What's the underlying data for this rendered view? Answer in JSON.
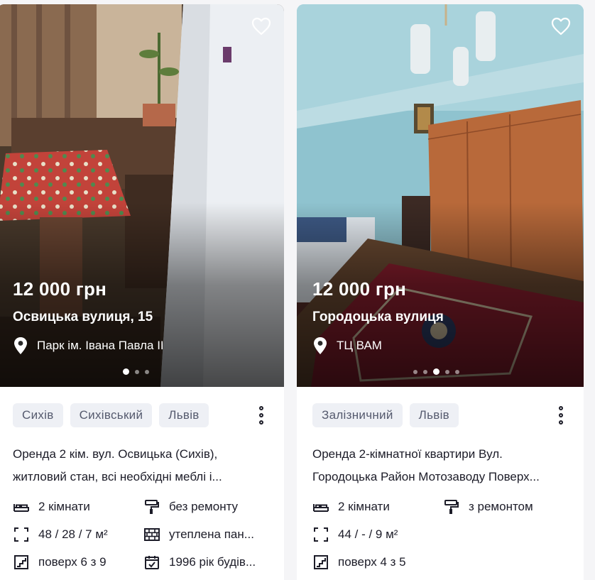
{
  "listings": [
    {
      "price": "12 000 грн",
      "street": "Освицька вулиця, 15",
      "district": "Парк ім. Івана Павла II",
      "favorite_icon": "heart-outline-icon",
      "tags": [
        "Сихів",
        "Сихівський",
        "Львів"
      ],
      "description": [
        "Оренда 2 кім. вул. Освицька (Сихів),",
        "житловий стан, всі необхідні меблі і..."
      ],
      "features": {
        "rooms": "2 кімнати",
        "area": "48 / 28 / 7 м²",
        "floor": "поверх 6 з 9",
        "renovation": "без ремонту",
        "walls": "утеплена пан...",
        "year": "1996 рік будів..."
      },
      "photo_count": 3,
      "active_photo": 0
    },
    {
      "price": "12 000 грн",
      "street": "Городоцька вулиця",
      "district": "ТЦ ВАМ",
      "favorite_icon": "heart-outline-icon",
      "tags": [
        "Залізничний",
        "Львів"
      ],
      "description": [
        "Оренда 2-кімнатної квартири Вул.",
        "Городоцька Район Мотозаводу Поверх..."
      ],
      "features": {
        "rooms": "2 кімнати",
        "area": "44 / - / 9 м²",
        "floor": "поверх 4 з 5",
        "renovation": "з ремонтом"
      },
      "photo_count": 5,
      "active_photo": 2
    }
  ]
}
